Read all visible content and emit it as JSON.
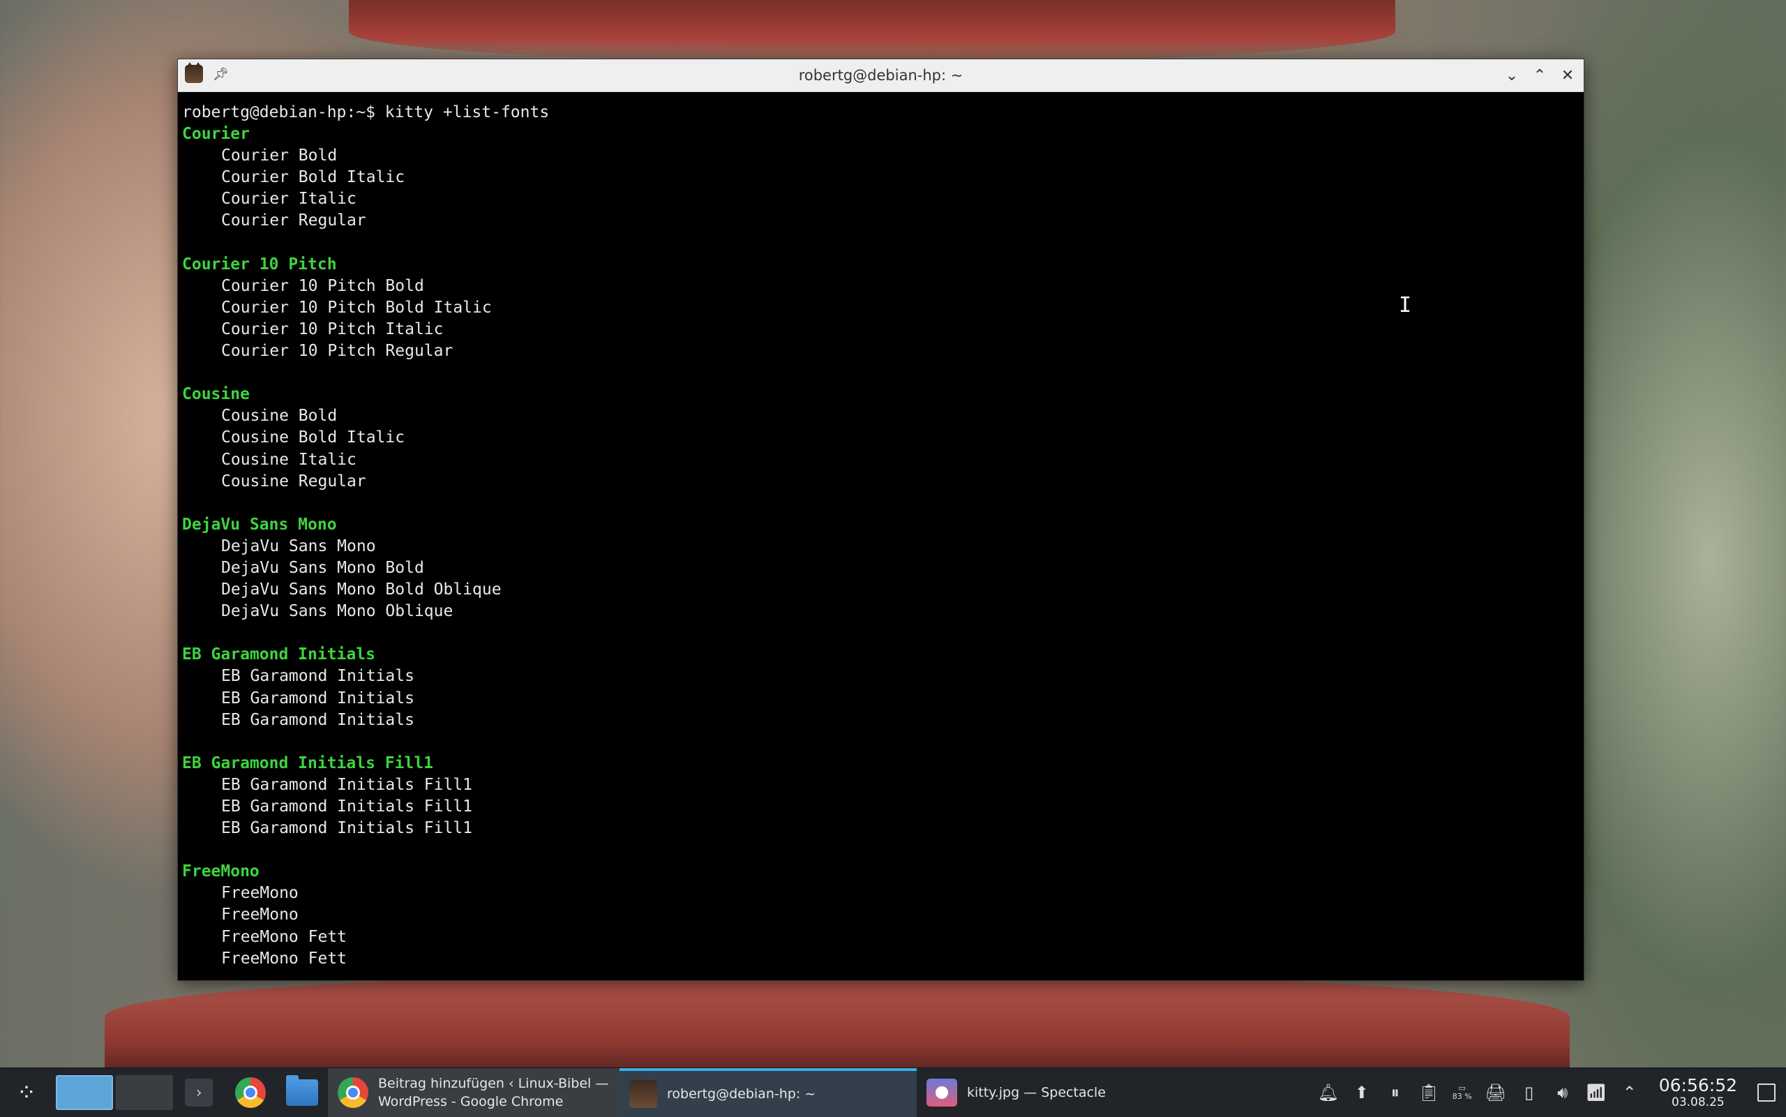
{
  "window": {
    "title": "robertg@debian-hp: ~",
    "buttons": {
      "minimize": "⌄",
      "maximize": "⌃",
      "close": "✕"
    }
  },
  "terminal": {
    "lines": [
      {
        "type": "prompt",
        "text": "robertg@debian-hp:~$ kitty +list-fonts"
      },
      {
        "type": "head",
        "text": "Courier"
      },
      {
        "type": "item",
        "text": "Courier Bold"
      },
      {
        "type": "item",
        "text": "Courier Bold Italic"
      },
      {
        "type": "item",
        "text": "Courier Italic"
      },
      {
        "type": "item",
        "text": "Courier Regular"
      },
      {
        "type": "blank",
        "text": ""
      },
      {
        "type": "head",
        "text": "Courier 10 Pitch"
      },
      {
        "type": "item",
        "text": "Courier 10 Pitch Bold"
      },
      {
        "type": "item",
        "text": "Courier 10 Pitch Bold Italic"
      },
      {
        "type": "item",
        "text": "Courier 10 Pitch Italic"
      },
      {
        "type": "item",
        "text": "Courier 10 Pitch Regular"
      },
      {
        "type": "blank",
        "text": ""
      },
      {
        "type": "head",
        "text": "Cousine"
      },
      {
        "type": "item",
        "text": "Cousine Bold"
      },
      {
        "type": "item",
        "text": "Cousine Bold Italic"
      },
      {
        "type": "item",
        "text": "Cousine Italic"
      },
      {
        "type": "item",
        "text": "Cousine Regular"
      },
      {
        "type": "blank",
        "text": ""
      },
      {
        "type": "head",
        "text": "DejaVu Sans Mono"
      },
      {
        "type": "item",
        "text": "DejaVu Sans Mono"
      },
      {
        "type": "item",
        "text": "DejaVu Sans Mono Bold"
      },
      {
        "type": "item",
        "text": "DejaVu Sans Mono Bold Oblique"
      },
      {
        "type": "item",
        "text": "DejaVu Sans Mono Oblique"
      },
      {
        "type": "blank",
        "text": ""
      },
      {
        "type": "head",
        "text": "EB Garamond Initials"
      },
      {
        "type": "item",
        "text": "EB Garamond Initials"
      },
      {
        "type": "item",
        "text": "EB Garamond Initials"
      },
      {
        "type": "item",
        "text": "EB Garamond Initials"
      },
      {
        "type": "blank",
        "text": ""
      },
      {
        "type": "head",
        "text": "EB Garamond Initials Fill1"
      },
      {
        "type": "item",
        "text": "EB Garamond Initials Fill1"
      },
      {
        "type": "item",
        "text": "EB Garamond Initials Fill1"
      },
      {
        "type": "item",
        "text": "EB Garamond Initials Fill1"
      },
      {
        "type": "blank",
        "text": ""
      },
      {
        "type": "head",
        "text": "FreeMono"
      },
      {
        "type": "item",
        "text": "FreeMono"
      },
      {
        "type": "item",
        "text": "FreeMono"
      },
      {
        "type": "item",
        "text": "FreeMono Fett"
      },
      {
        "type": "item",
        "text": "FreeMono Fett"
      }
    ]
  },
  "taskbar": {
    "tasks": [
      {
        "label": "Beitrag hinzufügen ‹ Linux-Bibel —\nWordPress - Google Chrome",
        "icon": "chrome-icon"
      },
      {
        "label": "robertg@debian-hp: ~",
        "icon": "kitty-icon"
      },
      {
        "label": "kitty.jpg — Spectacle",
        "icon": "spectacle-icon"
      }
    ],
    "tray": {
      "battery_percent": "83 %",
      "time": "06:56:52",
      "date": "03.08.25"
    }
  },
  "colors": {
    "terminal_bg": "#000000",
    "heading_green": "#3ed43e",
    "text": "#e8e8e8",
    "taskbar": "#212428",
    "accent": "#3daee9"
  }
}
